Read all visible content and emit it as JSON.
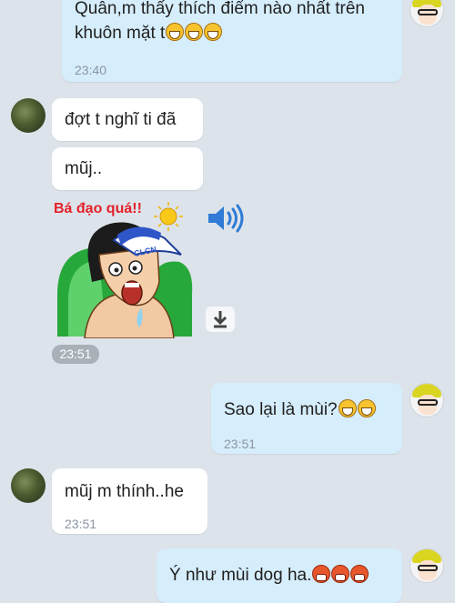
{
  "messages": [
    {
      "sender": "me",
      "lines": [
        "Quân,m thấy thích điểm nào nhất trên",
        "khuôn mặt t"
      ],
      "emoji": [
        "grin",
        "grin",
        "grin"
      ],
      "time": "23:40"
    },
    {
      "sender": "other",
      "text": "đợt t nghĩ ti đã"
    },
    {
      "sender": "other",
      "text": "mũj.."
    },
    {
      "sender": "other",
      "sticker": {
        "caption": "Bá đạo quá!!",
        "cap_text": "CLCN"
      },
      "time": "23:51"
    },
    {
      "sender": "me",
      "text": "Sao lại là mùi?",
      "emoji": [
        "grin",
        "grin"
      ],
      "time": "23:51"
    },
    {
      "sender": "other",
      "text": "mũj m thính..he",
      "time": "23:51"
    },
    {
      "sender": "me",
      "text": "Ý như mùi dog ha.",
      "emoji": [
        "angry",
        "angry",
        "angry"
      ]
    }
  ],
  "icons": {
    "speaker": "speaker-icon",
    "download": "download-icon"
  },
  "colors": {
    "background": "#dde3ea",
    "my_bubble": "#d6edfb",
    "their_bubble": "#ffffff",
    "accent": "#2f7bd6"
  }
}
